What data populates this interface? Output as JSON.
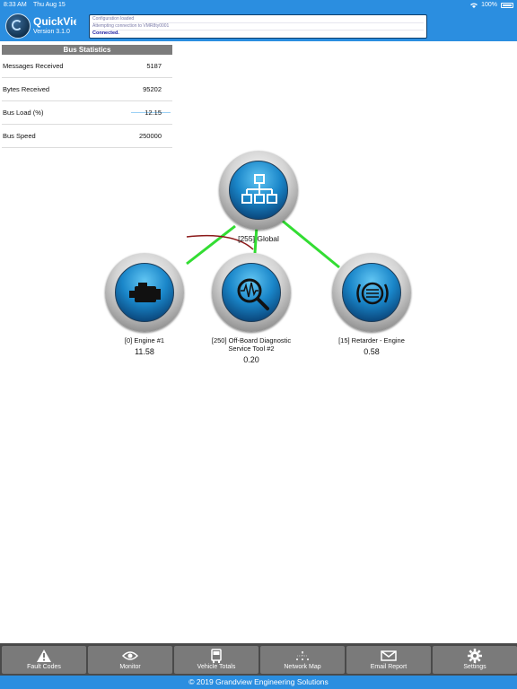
{
  "status_bar": {
    "time": "8:33 AM",
    "date": "Thu Aug 15",
    "battery": "100%"
  },
  "app": {
    "title": "QuickView",
    "version": "Version 3.1.0"
  },
  "console": {
    "lines": [
      "Configuration loaded",
      "Attempting connection to VMR8ty0001",
      "Connected."
    ]
  },
  "bus_stats": {
    "header": "Bus Statistics",
    "rows": [
      {
        "label": "Messages Received",
        "value": "5187"
      },
      {
        "label": "Bytes Received",
        "value": "95202"
      },
      {
        "label": "Bus Load (%)",
        "value": "12.15"
      },
      {
        "label": "Bus Speed",
        "value": "250000"
      }
    ]
  },
  "network_map": {
    "global": {
      "label": "[255] Global"
    },
    "nodes": [
      {
        "label": "[0] Engine #1",
        "value": "11.58"
      },
      {
        "label_line1": "[250] Off-Board Diagnostic",
        "label_line2": "Service Tool #2",
        "value": "0.20"
      },
      {
        "label": "[15] Retarder - Engine",
        "value": "0.58"
      }
    ]
  },
  "tabs": [
    {
      "label": "Fault Codes",
      "icon": "warning-icon"
    },
    {
      "label": "Monitor",
      "icon": "eye-icon"
    },
    {
      "label": "Vehicle Totals",
      "icon": "truck-icon"
    },
    {
      "label": "Network Map",
      "icon": "network-icon"
    },
    {
      "label": "Email Report",
      "icon": "envelope-icon"
    },
    {
      "label": "Settings",
      "icon": "gear-icon"
    }
  ],
  "footer": {
    "copyright": "© 2019 Grandview Engineering Solutions"
  },
  "colors": {
    "accent": "#2b8ee0",
    "link_line": "#33dd33",
    "arc": "#8b1a1a"
  }
}
